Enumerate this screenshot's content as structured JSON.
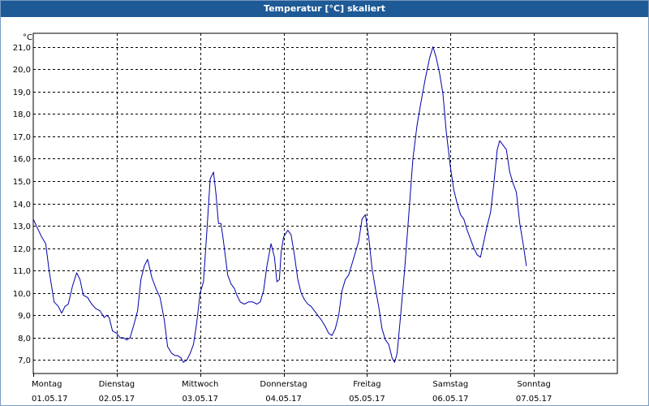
{
  "window": {
    "title": "Temperatur [°C] skaliert"
  },
  "chart_data": {
    "type": "line",
    "title": "Temperatur [°C] skaliert",
    "ylabel": "°C",
    "xlabel": "",
    "ylim": [
      6.4,
      21.6
    ],
    "yticks": [
      7.0,
      8.0,
      9.0,
      10.0,
      11.0,
      12.0,
      13.0,
      14.0,
      15.0,
      16.0,
      17.0,
      18.0,
      19.0,
      20.0,
      21.0
    ],
    "ytick_labels": [
      "7,0",
      "8,0",
      "9,0",
      "10,0",
      "11,0",
      "12,0",
      "13,0",
      "14,0",
      "15,0",
      "16,0",
      "17,0",
      "18,0",
      "19,0",
      "20,0",
      "21,0"
    ],
    "xlim": [
      0,
      7
    ],
    "days": [
      {
        "name": "Montag",
        "date": "01.05.17"
      },
      {
        "name": "Dienstag",
        "date": "02.05.17"
      },
      {
        "name": "Mittwoch",
        "date": "03.05.17"
      },
      {
        "name": "Donnerstag",
        "date": "04.05.17"
      },
      {
        "name": "Freitag",
        "date": "05.05.17"
      },
      {
        "name": "Samstag",
        "date": "06.05.17"
      },
      {
        "name": "Sonntag",
        "date": "07.05.17"
      }
    ],
    "grid": true,
    "series": [
      {
        "color": "#0000aa",
        "points": [
          [
            0.0,
            13.3
          ],
          [
            0.05,
            12.9
          ],
          [
            0.1,
            12.5
          ],
          [
            0.15,
            12.2
          ],
          [
            0.19,
            11.0
          ],
          [
            0.25,
            9.6
          ],
          [
            0.3,
            9.4
          ],
          [
            0.34,
            9.1
          ],
          [
            0.38,
            9.4
          ],
          [
            0.42,
            9.5
          ],
          [
            0.47,
            10.3
          ],
          [
            0.52,
            10.9
          ],
          [
            0.56,
            10.6
          ],
          [
            0.6,
            9.9
          ],
          [
            0.65,
            9.8
          ],
          [
            0.7,
            9.5
          ],
          [
            0.75,
            9.3
          ],
          [
            0.8,
            9.2
          ],
          [
            0.85,
            8.9
          ],
          [
            0.88,
            9.0
          ],
          [
            0.91,
            8.9
          ],
          [
            0.95,
            8.3
          ],
          [
            1.0,
            8.2
          ],
          [
            1.04,
            8.0
          ],
          [
            1.08,
            8.0
          ],
          [
            1.12,
            7.9
          ],
          [
            1.16,
            8.0
          ],
          [
            1.2,
            8.5
          ],
          [
            1.25,
            9.2
          ],
          [
            1.29,
            10.6
          ],
          [
            1.33,
            11.2
          ],
          [
            1.37,
            11.5
          ],
          [
            1.42,
            10.7
          ],
          [
            1.47,
            10.2
          ],
          [
            1.52,
            9.8
          ],
          [
            1.57,
            8.8
          ],
          [
            1.61,
            7.6
          ],
          [
            1.66,
            7.3
          ],
          [
            1.7,
            7.2
          ],
          [
            1.73,
            7.2
          ],
          [
            1.77,
            7.1
          ],
          [
            1.8,
            6.9
          ],
          [
            1.84,
            7.0
          ],
          [
            1.88,
            7.3
          ],
          [
            1.92,
            7.7
          ],
          [
            1.96,
            8.7
          ],
          [
            2.0,
            10.0
          ],
          [
            2.04,
            10.5
          ],
          [
            2.08,
            12.7
          ],
          [
            2.12,
            15.1
          ],
          [
            2.16,
            15.4
          ],
          [
            2.19,
            14.4
          ],
          [
            2.22,
            13.1
          ],
          [
            2.25,
            13.1
          ],
          [
            2.28,
            12.3
          ],
          [
            2.33,
            10.8
          ],
          [
            2.37,
            10.4
          ],
          [
            2.41,
            10.2
          ],
          [
            2.44,
            9.9
          ],
          [
            2.48,
            9.6
          ],
          [
            2.53,
            9.5
          ],
          [
            2.58,
            9.6
          ],
          [
            2.63,
            9.6
          ],
          [
            2.68,
            9.5
          ],
          [
            2.72,
            9.6
          ],
          [
            2.76,
            10.1
          ],
          [
            2.8,
            11.2
          ],
          [
            2.85,
            12.2
          ],
          [
            2.89,
            11.6
          ],
          [
            2.92,
            10.5
          ],
          [
            2.95,
            10.6
          ],
          [
            2.97,
            11.8
          ],
          [
            3.0,
            12.5
          ],
          [
            3.05,
            12.8
          ],
          [
            3.09,
            12.6
          ],
          [
            3.13,
            11.7
          ],
          [
            3.17,
            10.6
          ],
          [
            3.21,
            10.0
          ],
          [
            3.25,
            9.7
          ],
          [
            3.29,
            9.5
          ],
          [
            3.33,
            9.4
          ],
          [
            3.37,
            9.2
          ],
          [
            3.41,
            9.0
          ],
          [
            3.45,
            8.8
          ],
          [
            3.5,
            8.5
          ],
          [
            3.54,
            8.2
          ],
          [
            3.58,
            8.1
          ],
          [
            3.62,
            8.4
          ],
          [
            3.66,
            9.0
          ],
          [
            3.7,
            10.1
          ],
          [
            3.74,
            10.6
          ],
          [
            3.78,
            10.8
          ],
          [
            3.82,
            11.3
          ],
          [
            3.86,
            11.8
          ],
          [
            3.9,
            12.3
          ],
          [
            3.94,
            13.3
          ],
          [
            3.98,
            13.5
          ],
          [
            4.02,
            12.5
          ],
          [
            4.06,
            11.1
          ],
          [
            4.1,
            10.2
          ],
          [
            4.14,
            9.4
          ],
          [
            4.18,
            8.4
          ],
          [
            4.22,
            7.9
          ],
          [
            4.26,
            7.7
          ],
          [
            4.3,
            7.1
          ],
          [
            4.33,
            6.9
          ],
          [
            4.36,
            7.3
          ],
          [
            4.4,
            8.9
          ],
          [
            4.45,
            11.0
          ],
          [
            4.5,
            13.5
          ],
          [
            4.55,
            16.0
          ],
          [
            4.6,
            17.5
          ],
          [
            4.65,
            18.6
          ],
          [
            4.7,
            19.6
          ],
          [
            4.75,
            20.5
          ],
          [
            4.79,
            21.0
          ],
          [
            4.83,
            20.5
          ],
          [
            4.87,
            19.8
          ],
          [
            4.91,
            18.9
          ],
          [
            4.95,
            17.2
          ],
          [
            5.0,
            15.6
          ],
          [
            5.04,
            14.6
          ],
          [
            5.08,
            14.0
          ],
          [
            5.12,
            13.5
          ],
          [
            5.16,
            13.3
          ],
          [
            5.2,
            12.8
          ],
          [
            5.24,
            12.4
          ],
          [
            5.28,
            12.0
          ],
          [
            5.32,
            11.7
          ],
          [
            5.36,
            11.6
          ],
          [
            5.4,
            12.3
          ],
          [
            5.44,
            13.0
          ],
          [
            5.48,
            13.6
          ],
          [
            5.52,
            14.9
          ],
          [
            5.56,
            16.4
          ],
          [
            5.59,
            16.8
          ],
          [
            5.63,
            16.6
          ],
          [
            5.67,
            16.4
          ],
          [
            5.71,
            15.4
          ],
          [
            5.75,
            14.9
          ],
          [
            5.79,
            14.5
          ],
          [
            5.83,
            13.1
          ],
          [
            5.87,
            12.2
          ],
          [
            5.91,
            11.2
          ]
        ]
      }
    ]
  }
}
